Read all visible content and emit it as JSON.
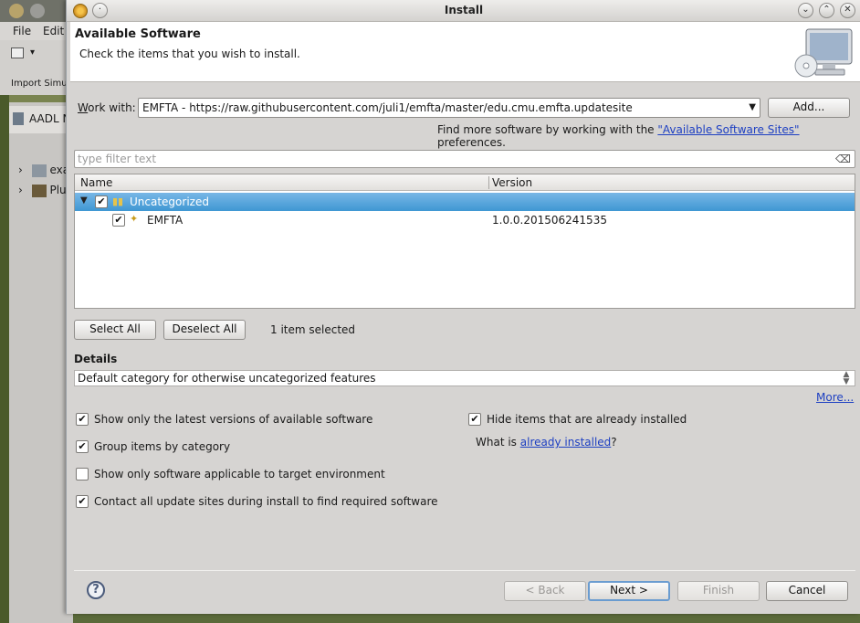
{
  "background_window": {
    "menu": [
      "File",
      "Edit"
    ],
    "import_label": "Import Simu",
    "view_tab": "AADL N",
    "tree_items": [
      "exa",
      "Plu"
    ]
  },
  "dialog": {
    "title": "Install",
    "header_title": "Available Software",
    "header_desc": "Check the items that you wish to install."
  },
  "work_with": {
    "label_prefix": "W",
    "label_rest": "ork with:",
    "value": "EMFTA - https://raw.githubusercontent.com/juli1/emfta/master/edu.cmu.emfta.updatesite",
    "add_button": "Add...",
    "find_more_prefix": "Find more software by working with the ",
    "find_more_link": "\"Available Software Sites\"",
    "find_more_suffix": " preferences."
  },
  "filter": {
    "placeholder": "type filter text"
  },
  "table": {
    "columns": [
      "Name",
      "Version"
    ],
    "rows": [
      {
        "name": "Uncategorized",
        "version": "",
        "checked": true,
        "selected": true,
        "expanded": true
      },
      {
        "name": "EMFTA",
        "version": "1.0.0.201506241535",
        "checked": true,
        "selected": false
      }
    ]
  },
  "selection": {
    "select_all": "Select All",
    "deselect_all": "Deselect All",
    "status": "1 item selected"
  },
  "details": {
    "title": "Details",
    "text": "Default category for otherwise uncategorized features",
    "more_link": "More..."
  },
  "options": [
    {
      "label": "Show only the latest versions of available software",
      "checked": true
    },
    {
      "label": "Group items by category",
      "checked": true
    },
    {
      "label": "Show only software applicable to target environment",
      "checked": false
    },
    {
      "label": "Contact all update sites during install to find required software",
      "checked": true
    },
    {
      "label": "Hide items that are already installed",
      "checked": true
    }
  ],
  "installed_question": {
    "prefix": "What is ",
    "link": "already installed",
    "suffix": "?"
  },
  "footer": {
    "back": "< Back",
    "next": "Next >",
    "finish": "Finish",
    "cancel": "Cancel"
  }
}
